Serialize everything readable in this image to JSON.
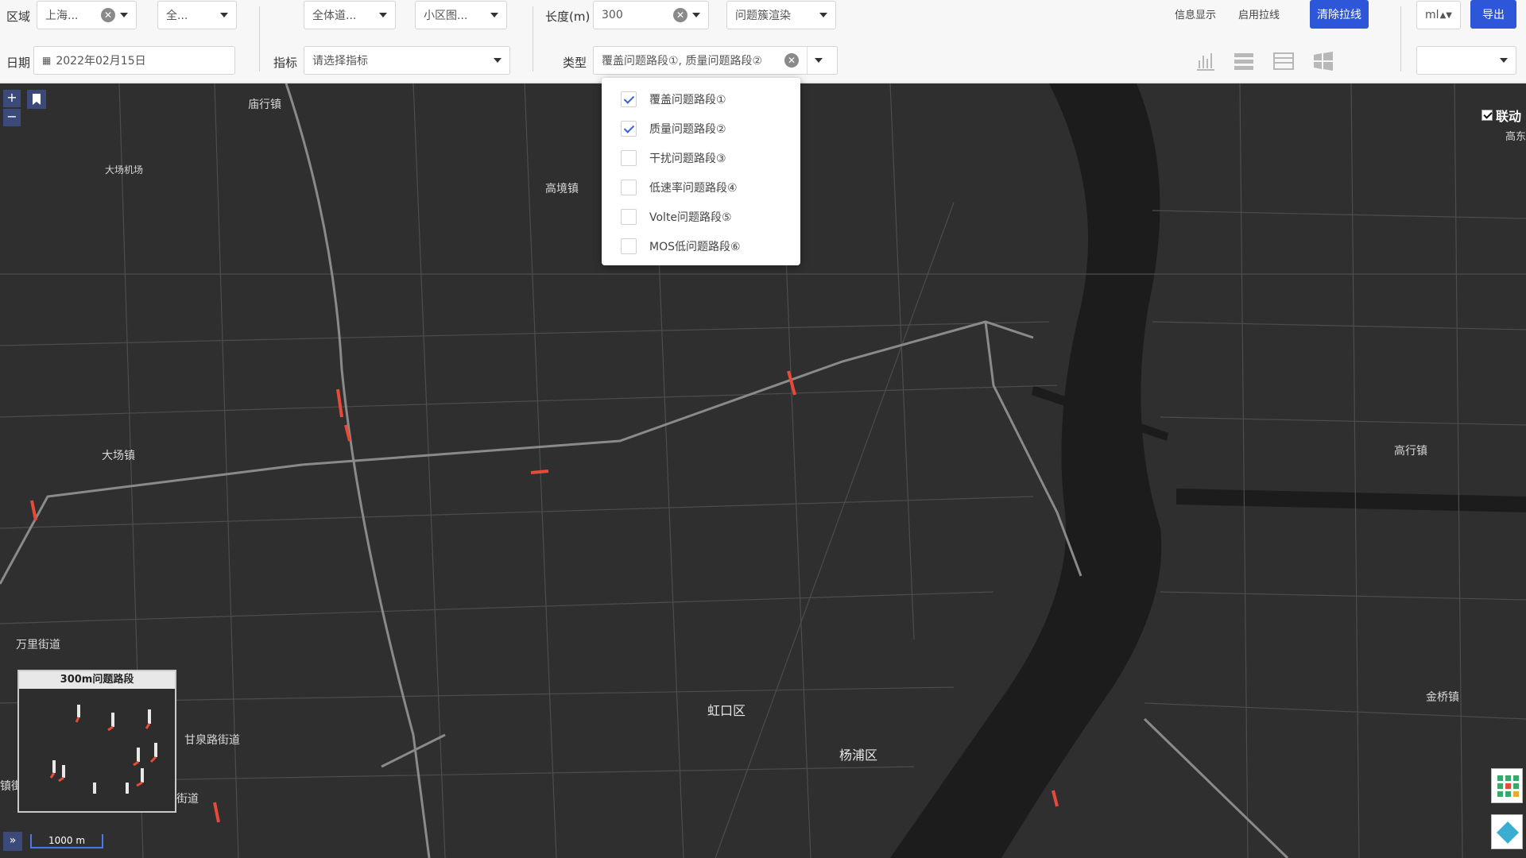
{
  "toolbar": {
    "region_label": "区域",
    "region_value": "上海...",
    "region_sub_value": "全...",
    "road_value": "全体道...",
    "cell_value": "小区图...",
    "length_label": "长度(m)",
    "length_value": "300",
    "render_value": "问题簇渲染",
    "info_btn": "信息显示",
    "pull_btn": "启用拉线",
    "clear_btn": "清除拉线",
    "unit_value": "ml",
    "export_btn": "导出",
    "date_label": "日期",
    "date_value": "2022年02月15日",
    "metric_label": "指标",
    "metric_placeholder": "请选择指标",
    "type_label": "类型",
    "type_value": "覆盖问题路段①, 质量问题路段②",
    "view_icons": [
      "bar-chart-icon",
      "list-view-icon",
      "table-view-icon",
      "windows-icon"
    ]
  },
  "type_options": [
    {
      "label": "覆盖问题路段①",
      "checked": true
    },
    {
      "label": "质量问题路段②",
      "checked": true
    },
    {
      "label": "干扰问题路段③",
      "checked": false
    },
    {
      "label": "低速率问题路段④",
      "checked": false
    },
    {
      "label": "Volte问题路段⑤",
      "checked": false
    },
    {
      "label": "MOS低问题路段⑥",
      "checked": false
    }
  ],
  "map": {
    "labels": {
      "l1": "庙行镇",
      "l2": "大场机场",
      "l3": "高境镇",
      "l4": "大场镇",
      "l5": "万里街道",
      "l6": "甘泉路街道",
      "l7": "虹口区",
      "l8": "杨浦区",
      "l9": "高行镇",
      "l10": "金桥镇",
      "l11": "高东",
      "l12": "街道",
      "l13": "镇街"
    },
    "linkage_label": "联动",
    "minimap_title": "300m问题路段",
    "scale_label": "1000 m",
    "zoom_in": "+",
    "zoom_out": "−",
    "expand_symbol": "»"
  },
  "colors": {
    "primary": "#2d56d8",
    "map_bg": "#2f2f30",
    "river": "#1c1c1d",
    "road": "#8a8a8a",
    "problem_segment": "#e84a3a"
  }
}
